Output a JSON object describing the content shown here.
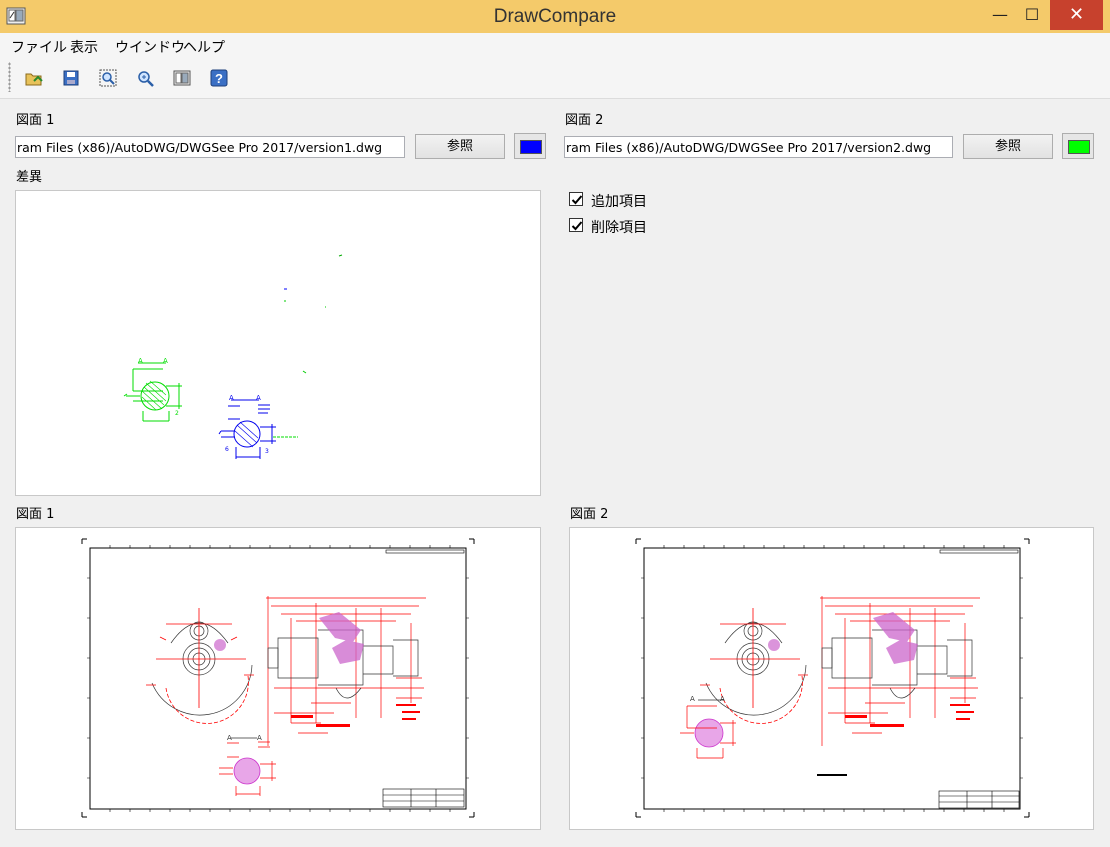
{
  "window": {
    "title": "DrawCompare",
    "minimize_glyph": "—",
    "maximize_glyph": "☐",
    "close_glyph": "✕"
  },
  "menu": [
    "ファイル",
    "表示",
    "ウインドウ",
    "ヘルプ"
  ],
  "toolbar": {
    "buttons": [
      "open-icon",
      "save-icon",
      "zoom-extents-icon",
      "zoom-window-icon",
      "compare-icon",
      "help-icon"
    ]
  },
  "drawing1": {
    "label": "図面 1",
    "path": "ram Files (x86)/AutoDWG/DWGSee Pro 2017/version1.dwg",
    "browse_label": "参照",
    "color": "#0000ff"
  },
  "drawing2": {
    "label": "図面 2",
    "path": "ram Files (x86)/AutoDWG/DWGSee Pro 2017/version2.dwg",
    "browse_label": "参照",
    "color": "#00ff00"
  },
  "diff": {
    "label": "差異"
  },
  "options": {
    "added": {
      "label": "追加項目",
      "checked": true
    },
    "deleted": {
      "label": "削除項目",
      "checked": true
    }
  },
  "preview1": {
    "label": "図面 1"
  },
  "preview2": {
    "label": "図面 2"
  },
  "colors": {
    "titlebar": "#f4ca6a",
    "close": "#c7412d",
    "added": "#00ff00",
    "deleted": "#0000ff",
    "drawing_red": "#ff0000",
    "hatch": "#cc66cc"
  }
}
